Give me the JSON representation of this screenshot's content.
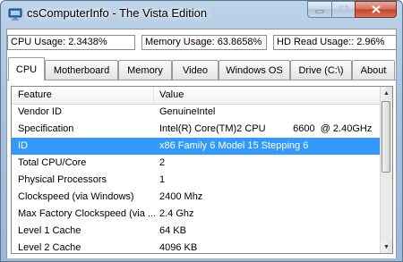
{
  "window": {
    "title": "csComputerInfo - The Vista Edition"
  },
  "status": {
    "cpu_usage": "CPU Usage: 2.3438%",
    "memory_usage": "Memory Usage: 63.8658%",
    "hd_read_usage": "HD Read Usage:: 2.96%"
  },
  "tabs": [
    {
      "label": "CPU",
      "active": true
    },
    {
      "label": "Motherboard"
    },
    {
      "label": "Memory"
    },
    {
      "label": "Video"
    },
    {
      "label": "Windows OS"
    },
    {
      "label": "Drive (C:\\)"
    },
    {
      "label": "About"
    }
  ],
  "table": {
    "headers": [
      "Feature",
      "Value"
    ],
    "rows": [
      [
        "Vendor ID",
        "GenuineIntel"
      ],
      [
        "Specification",
        "Intel(R) Core(TM)2 CPU          6600  @ 2.40GHz"
      ],
      [
        "ID",
        "x86 Family 6 Model 15 Stepping 6"
      ],
      [
        "Total CPU/Core",
        "2"
      ],
      [
        "Physical Processors",
        "1"
      ],
      [
        "Clockspeed (via Windows)",
        "2400 Mhz"
      ],
      [
        "Max Factory Clockspeed (via ...",
        "2.4 Ghz"
      ],
      [
        "Level 1 Cache",
        "64 KB"
      ],
      [
        "Level 2 Cache",
        "4096 KB"
      ]
    ],
    "selected_row": 2
  },
  "colors": {
    "selection": "#3399ff",
    "close_button": "#c4432a"
  },
  "icons": {
    "app": "computer-icon",
    "minimize": "minimize-icon",
    "maximize": "maximize-icon",
    "close": "close-icon"
  }
}
